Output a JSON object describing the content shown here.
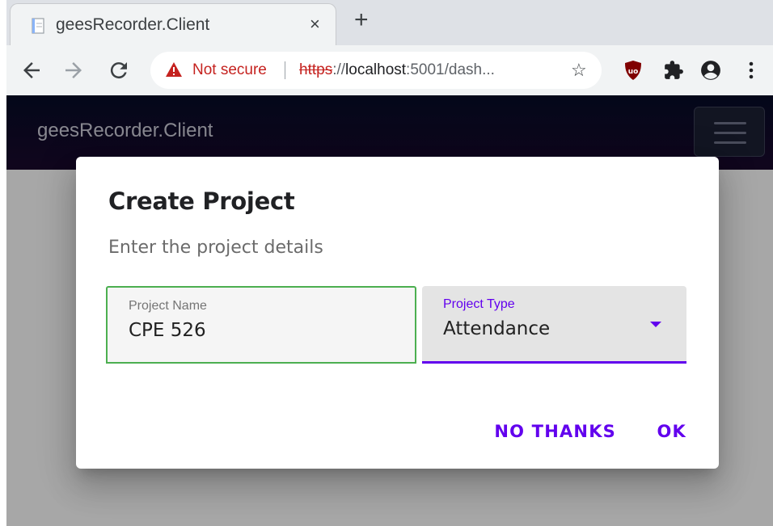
{
  "tab": {
    "title": "geesRecorder.Client",
    "close": "×",
    "favicon": "page-icon"
  },
  "new_tab": "+",
  "toolbar": {
    "back": "arrow-left-icon",
    "forward": "arrow-right-icon",
    "reload": "reload-icon",
    "security_label": "Not secure",
    "url_scheme": "https",
    "url_sep": "://",
    "url_host": "localhost",
    "url_rest": ":5001/dash...",
    "bookmark": "☆"
  },
  "app": {
    "brand": "geesRecorder.Client",
    "menu_icon": "hamburger-icon"
  },
  "dialog": {
    "title": "Create Project",
    "text": "Enter the project details",
    "fields": {
      "name_label": "Project Name",
      "name_value": "CPE 526",
      "type_label": "Project Type",
      "type_value": "Attendance"
    },
    "buttons": {
      "cancel": "NO THANKS",
      "ok": "OK"
    }
  },
  "colors": {
    "accent": "#6200ee",
    "focus_green": "#4caf50",
    "warning_red": "#c5221f",
    "appbar": "#050b26"
  }
}
